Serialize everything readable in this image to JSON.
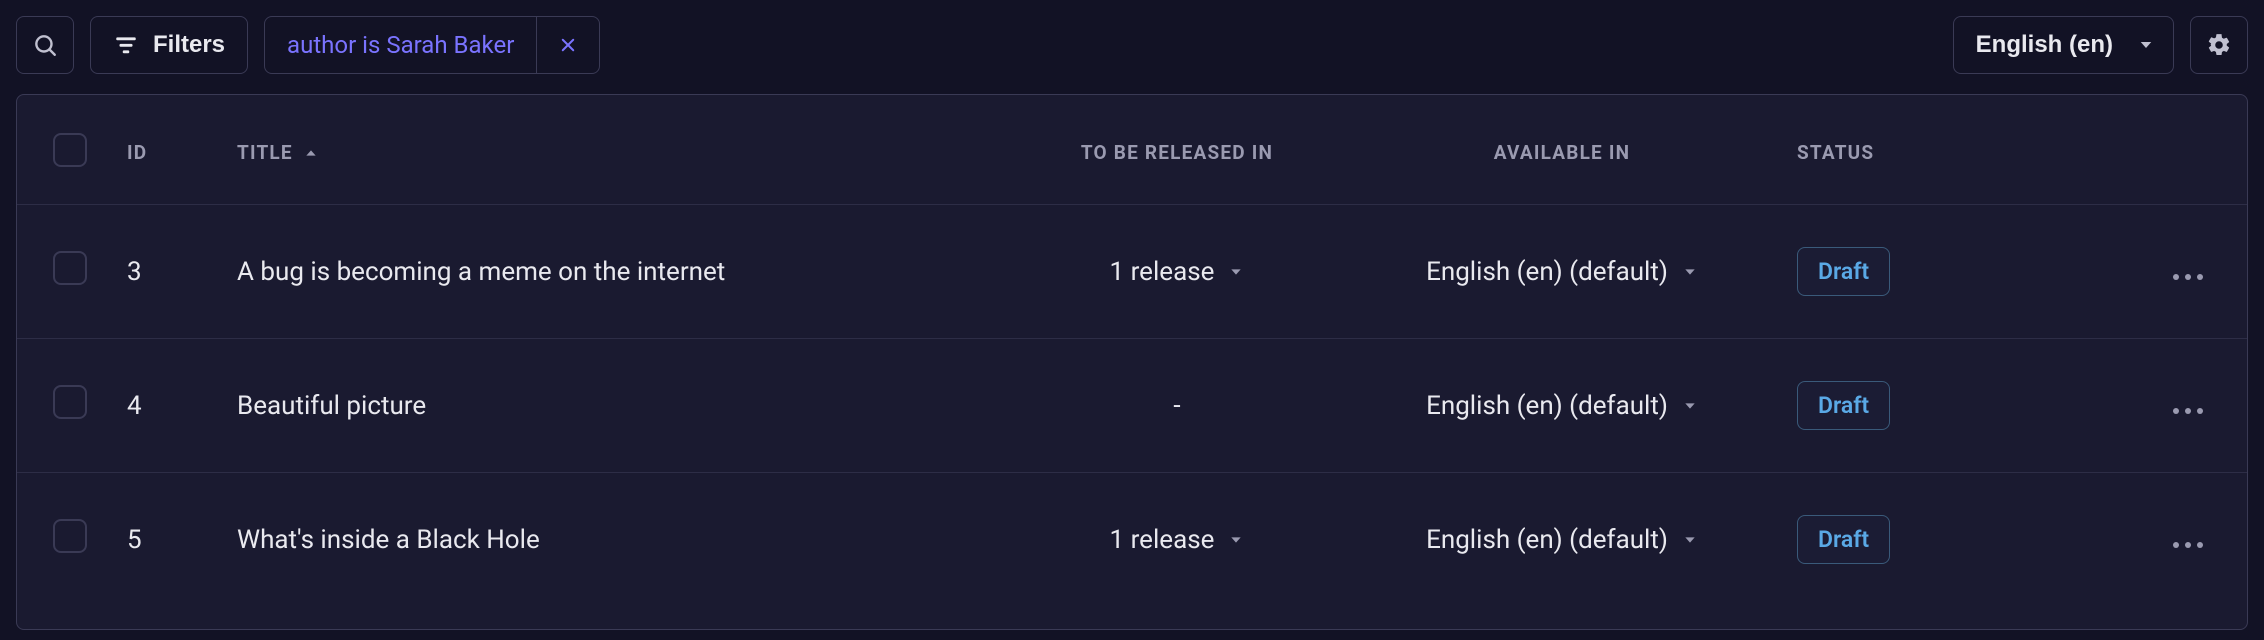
{
  "toolbar": {
    "filters_label": "Filters",
    "active_filter": "author is Sarah Baker",
    "locale_label": "English (en)"
  },
  "columns": {
    "id": "ID",
    "title": "TITLE",
    "release": "TO BE RELEASED IN",
    "available": "AVAILABLE IN",
    "status": "STATUS"
  },
  "rows": [
    {
      "id": "3",
      "title": "A bug is becoming a meme on the internet",
      "release": "1 release",
      "available": "English (en) (default)",
      "status": "Draft"
    },
    {
      "id": "4",
      "title": "Beautiful picture",
      "release": "-",
      "available": "English (en) (default)",
      "status": "Draft"
    },
    {
      "id": "5",
      "title": "What's inside a Black Hole",
      "release": "1 release",
      "available": "English (en) (default)",
      "status": "Draft"
    }
  ]
}
